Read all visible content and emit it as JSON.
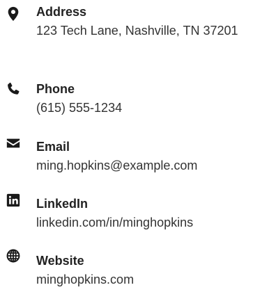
{
  "contacts": [
    {
      "icon": "map-marker-icon",
      "label": "Address",
      "value": "123 Tech Lane, Nashville, TN 37201"
    },
    {
      "icon": "phone-icon",
      "label": "Phone",
      "value": "(615) 555-1234"
    },
    {
      "icon": "envelope-icon",
      "label": "Email",
      "value": "ming.hopkins@example.com"
    },
    {
      "icon": "linkedin-icon",
      "label": "LinkedIn",
      "value": "linkedin.com/in/minghopkins"
    },
    {
      "icon": "globe-icon",
      "label": "Website",
      "value": "minghopkins.com"
    }
  ],
  "colors": {
    "text": "#333333",
    "label": "#222222",
    "icon": "#1a1a1a"
  }
}
